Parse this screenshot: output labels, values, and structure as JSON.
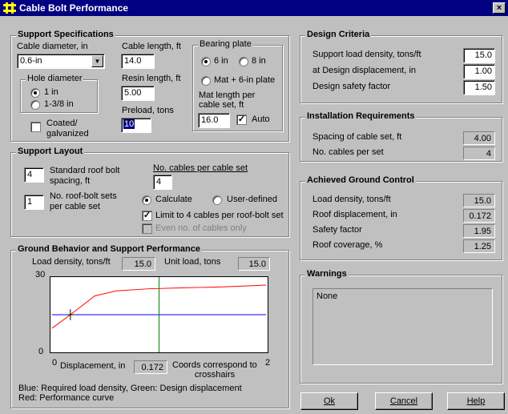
{
  "window": {
    "title": "Cable Bolt Performance",
    "close_glyph": "×"
  },
  "support_specs": {
    "title": "Support Specifications",
    "cable_diameter_label": "Cable diameter, in",
    "cable_diameter_value": "0.6-in",
    "cable_length_label": "Cable length, ft",
    "cable_length_value": "14.0",
    "resin_length_label": "Resin length, ft",
    "resin_length_value": "5.00",
    "preload_label": "Preload, tons",
    "preload_value": "10",
    "hole_diameter": {
      "title": "Hole diameter",
      "options": [
        "1 in",
        "1-3/8 in"
      ],
      "selected": 0
    },
    "coated_label_1": "Coated/",
    "coated_label_2": "galvanized",
    "bearing_plate": {
      "title": "Bearing plate",
      "opt_6in": "6 in",
      "opt_8in": "8 in",
      "opt_mat": "Mat + 6-in plate",
      "selected": "6 in",
      "mat_length_label_1": "Mat length per",
      "mat_length_label_2": "cable set, ft",
      "mat_length_value": "16.0",
      "auto_label": "Auto",
      "auto_checked": true
    }
  },
  "support_layout": {
    "title": "Support Layout",
    "std_bolt_value": "4",
    "std_bolt_label_1": "Standard roof bolt",
    "std_bolt_label_2": "spacing, ft",
    "sets_value": "1",
    "sets_label_1": "No. roof-bolt sets",
    "sets_label_2": "per cable set",
    "cables_per_set_label": "No. cables per cable set",
    "cables_per_set_value": "4",
    "calculate_label": "Calculate",
    "user_defined_label": "User-defined",
    "limit_label": "Limit to 4 cables per roof-bolt set",
    "even_label": "Even no. of cables only"
  },
  "ground_behavior": {
    "title": "Ground Behavior and Support Performance",
    "load_density_label": "Load density, tons/ft",
    "load_density_value": "15.0",
    "unit_load_label": "Unit load, tons",
    "unit_load_value": "15.0",
    "y_max": "30",
    "y_min": "0",
    "x_min": "0",
    "x_max": "2",
    "displacement_label": "Displacement, in",
    "displacement_value": "0.172",
    "coords_note_1": "Coords correspond to",
    "coords_note_2": "crosshairs",
    "legend_1": "Blue: Required load density, Green: Design displacement",
    "legend_2": "Red: Performance curve"
  },
  "chart_data": {
    "type": "line",
    "xlim": [
      0,
      2
    ],
    "ylim": [
      0,
      30
    ],
    "required_load_density": 15.0,
    "design_displacement": 1.0,
    "performance_curve": {
      "x": [
        0,
        0.172,
        0.4,
        0.6,
        0.9,
        1.2,
        1.6,
        2.0
      ],
      "y": [
        9.6,
        15.0,
        22.5,
        24.5,
        25.3,
        25.7,
        26.1,
        26.8
      ]
    },
    "crosshair": {
      "x": 0.172,
      "y": 15.0
    },
    "colors": {
      "required": "#0000ff",
      "design": "#008000",
      "performance": "#ff0000",
      "crosshair": "#000000"
    }
  },
  "design_criteria": {
    "title": "Design Criteria",
    "rows": [
      {
        "label": "Support load density, tons/ft",
        "value": "15.0"
      },
      {
        "label": "at Design displacement, in",
        "value": "1.00"
      },
      {
        "label": "Design safety factor",
        "value": "1.50"
      }
    ]
  },
  "installation": {
    "title": "Installation Requirements",
    "rows": [
      {
        "label": "Spacing of cable set, ft",
        "value": "4.00"
      },
      {
        "label": "No. cables per set",
        "value": "4"
      }
    ]
  },
  "achieved": {
    "title": "Achieved Ground Control",
    "rows": [
      {
        "label": "Load density, tons/ft",
        "value": "15.0"
      },
      {
        "label": "Roof displacement, in",
        "value": "0.172"
      },
      {
        "label": "Safety factor",
        "value": "1.95"
      },
      {
        "label": "Roof coverage, %",
        "value": "1.25"
      }
    ]
  },
  "warnings": {
    "title": "Warnings",
    "text": "None"
  },
  "buttons": {
    "ok": "Ok",
    "cancel": "Cancel",
    "help": "Help"
  }
}
